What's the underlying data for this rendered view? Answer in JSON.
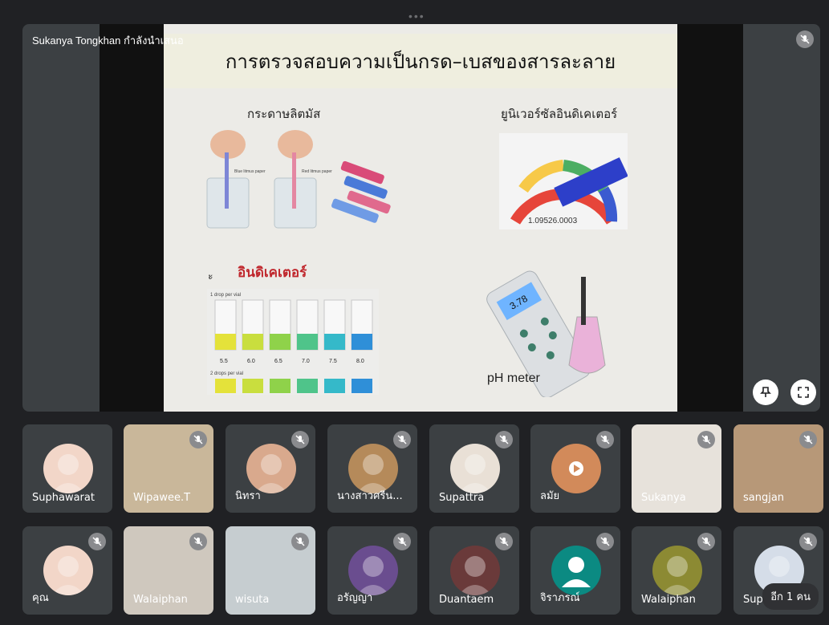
{
  "presenter": {
    "name_label": "Sukanya Tongkhan กำลังนำเสนอ"
  },
  "slide": {
    "title": "การตรวจสอบความเป็นกรด–เบสของสารละลาย",
    "litmus_label": "กระดาษลิตมัส",
    "universal_label": "ยูนิเวอร์ซัลอินดิเคเตอร์",
    "indicator_prefix": "ะ",
    "indicator_label": "อินดิเคเตอร์",
    "ph_meter_label": "pH meter",
    "litmus_blue": "Blue litmus paper",
    "litmus_red": "Red litmus paper",
    "vial_top_caption": "1 drop per vial",
    "vial_bottom_caption": "2 drops per vial",
    "vial_values": [
      "5.5",
      "6.0",
      "6.5",
      "7.0",
      "7.5",
      "8.0"
    ],
    "meter_reading": "3.78",
    "dial_text": "1.09526.0003"
  },
  "controls": {
    "pin_icon": "pin-icon",
    "fullscreen_icon": "fullscreen-icon"
  },
  "participants_row1": [
    {
      "name": "Suphawarat"
    },
    {
      "name": "Wipawee.T"
    },
    {
      "name": "นิทรา"
    },
    {
      "name": "นางสาวศรีน..."
    },
    {
      "name": "Supattra"
    },
    {
      "name": "ลมัย"
    },
    {
      "name": "Sukanya"
    },
    {
      "name": "sangjan"
    }
  ],
  "participants_row2": [
    {
      "name": "คุณ"
    },
    {
      "name": "Walaiphan"
    },
    {
      "name": "wisuta"
    },
    {
      "name": "อรัญญา"
    },
    {
      "name": "Duantaem"
    },
    {
      "name": "จิราภรณ์"
    },
    {
      "name": "Walaiphan"
    },
    {
      "name": "Supa"
    }
  ],
  "more_label": "อีก 1 คน",
  "colors": {
    "background": "#202124",
    "tile": "#3c4043",
    "red_label": "#c0272d"
  }
}
